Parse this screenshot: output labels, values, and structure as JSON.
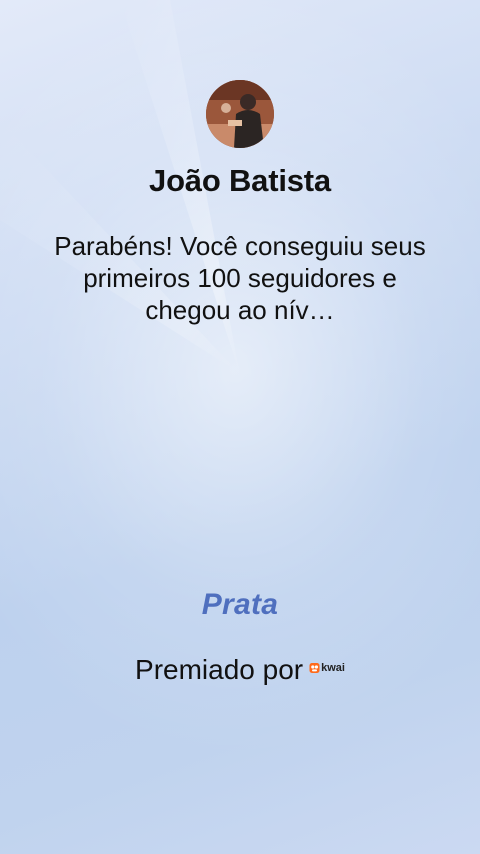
{
  "profile": {
    "name": "João Batista",
    "avatar": "user-avatar-photo"
  },
  "message": "Parabéns! Você conseguiu seus primeiros 100 seguidores e chegou ao nív…",
  "award": {
    "tier": "Prata",
    "awarded_by_label": "Premiado por",
    "brand_logo_text": "kwai"
  },
  "colors": {
    "tier_text": "#4f6fbe",
    "brand_accent": "#ff6a1a",
    "background_top": "#e3eaf9",
    "background_bottom": "#c0d3ee"
  }
}
